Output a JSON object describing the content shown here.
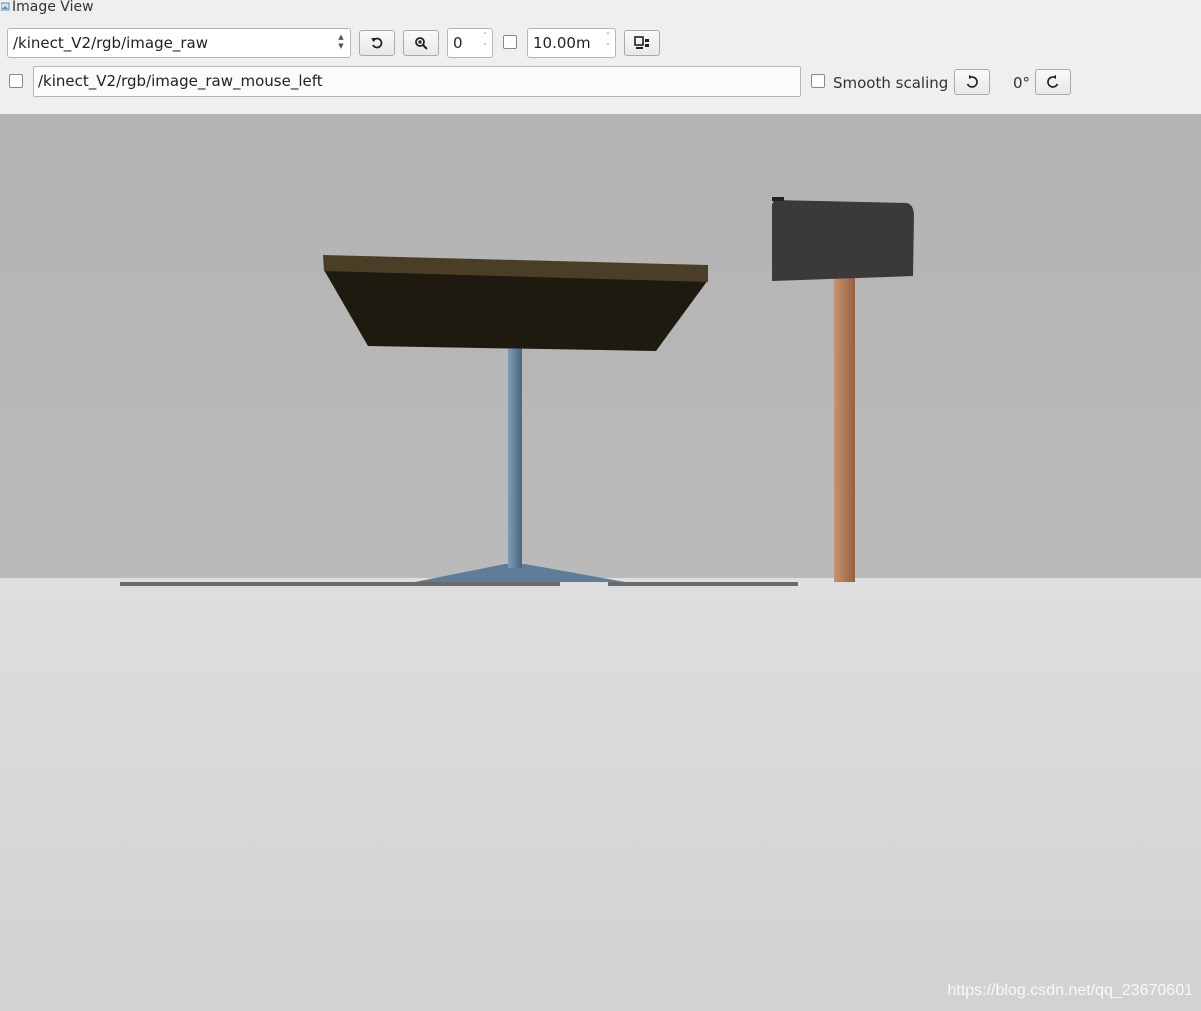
{
  "window": {
    "title": "Image View",
    "icon": "app-icon"
  },
  "toolbar": {
    "topic_select": {
      "value": "/kinect_V2/rgb/image_raw"
    },
    "refresh_button": {
      "icon": "refresh-icon"
    },
    "zoom_button": {
      "icon": "zoom-fit-icon"
    },
    "value_spin": {
      "value": "0"
    },
    "depth_checkbox": {
      "checked": false
    },
    "max_range_spin": {
      "value": "10.00m"
    },
    "save_button": {
      "icon": "save-image-icon"
    },
    "mouse_pub_checkbox": {
      "checked": false
    },
    "mouse_topic_input": {
      "value": "/kinect_V2/rgb/image_raw_mouse_left"
    },
    "smooth_scaling": {
      "label": "Smooth scaling",
      "checked": false
    },
    "rotate_left_button": {
      "icon": "rotate-left-icon"
    },
    "rotation": {
      "value": "0°"
    },
    "rotate_right_button": {
      "icon": "rotate-right-icon"
    }
  },
  "image": {
    "watermark": "https://blog.csdn.net/qq_23670601",
    "colors": {
      "wall": "#b4b4b4",
      "floor": "#d8d8d8",
      "tabletop": "#1e1a10",
      "table_edge": "#4a3e26",
      "table_leg": "#5b7896",
      "mailbox": "#3a3a3a",
      "post": "#b07a55"
    }
  }
}
